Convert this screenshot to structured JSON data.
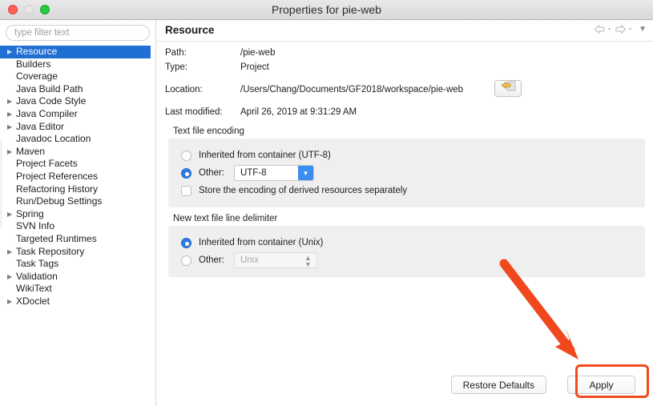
{
  "window": {
    "title": "Properties for pie-web",
    "traffic_lights": [
      "close-red",
      "minimize-disabled",
      "zoom-green"
    ]
  },
  "sidebar": {
    "filter": {
      "placeholder": "type filter text",
      "value": ""
    },
    "items": [
      {
        "label": "Resource",
        "expandable": true,
        "selected": true
      },
      {
        "label": "Builders",
        "expandable": false,
        "selected": false
      },
      {
        "label": "Coverage",
        "expandable": false,
        "selected": false
      },
      {
        "label": "Java Build Path",
        "expandable": false,
        "selected": false
      },
      {
        "label": "Java Code Style",
        "expandable": true,
        "selected": false
      },
      {
        "label": "Java Compiler",
        "expandable": true,
        "selected": false
      },
      {
        "label": "Java Editor",
        "expandable": true,
        "selected": false
      },
      {
        "label": "Javadoc Location",
        "expandable": false,
        "selected": false
      },
      {
        "label": "Maven",
        "expandable": true,
        "selected": false
      },
      {
        "label": "Project Facets",
        "expandable": false,
        "selected": false
      },
      {
        "label": "Project References",
        "expandable": false,
        "selected": false
      },
      {
        "label": "Refactoring History",
        "expandable": false,
        "selected": false
      },
      {
        "label": "Run/Debug Settings",
        "expandable": false,
        "selected": false
      },
      {
        "label": "Spring",
        "expandable": true,
        "selected": false
      },
      {
        "label": "SVN Info",
        "expandable": false,
        "selected": false
      },
      {
        "label": "Targeted Runtimes",
        "expandable": false,
        "selected": false
      },
      {
        "label": "Task Repository",
        "expandable": true,
        "selected": false
      },
      {
        "label": "Task Tags",
        "expandable": false,
        "selected": false
      },
      {
        "label": "Validation",
        "expandable": true,
        "selected": false
      },
      {
        "label": "WikiText",
        "expandable": false,
        "selected": false
      },
      {
        "label": "XDoclet",
        "expandable": true,
        "selected": false
      }
    ]
  },
  "main": {
    "page_title": "Resource",
    "nav": {
      "back_icon": "back-arrow-icon",
      "forward_icon": "forward-arrow-icon",
      "menu_icon": "view-menu-triangle-icon"
    },
    "info": {
      "path_label": "Path:",
      "path_value": "/pie-web",
      "type_label": "Type:",
      "type_value": "Project",
      "location_label": "Location:",
      "location_value": "/Users/Chang/Documents/GF2018/workspace/pie-web",
      "browse_icon": "folder-browse-icon",
      "modified_label": "Last modified:",
      "modified_value": "April 26, 2019 at 9:31:29 AM"
    },
    "encoding_group": {
      "title": "Text file encoding",
      "inherited_label": "Inherited from container (UTF-8)",
      "inherited_selected": false,
      "other_label": "Other:",
      "other_selected": true,
      "other_value": "UTF-8",
      "store_label": "Store the encoding of derived resources separately",
      "store_checked": false
    },
    "delimiter_group": {
      "title": "New text file line delimiter",
      "inherited_label": "Inherited from container (Unix)",
      "inherited_selected": true,
      "other_label": "Other:",
      "other_selected": false,
      "other_value": "Unix",
      "other_disabled": true
    },
    "footer": {
      "restore_label": "Restore Defaults",
      "apply_label": "Apply"
    }
  },
  "annotations": {
    "arrow_color": "#f0481c",
    "highlight_color": "#f04a1e",
    "arrow_target": "apply-button"
  }
}
